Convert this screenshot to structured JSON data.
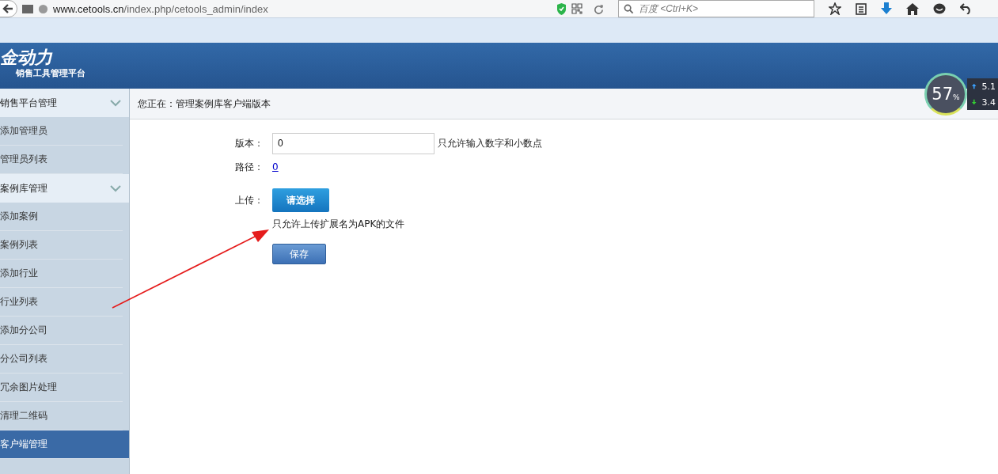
{
  "browser": {
    "url_host": "www.cetools.cn",
    "url_path": "/index.php/cetools_admin/index",
    "search_placeholder": "百度 <Ctrl+K>"
  },
  "header": {
    "logo_text": "金动力",
    "logo_subtitle": "销售工具管理平台"
  },
  "network_widget": {
    "percent": "57",
    "unit": "%",
    "upload": "5.1",
    "download": "3.4"
  },
  "breadcrumb": "您正在：管理案例库客户端版本",
  "sidebar": {
    "items": [
      {
        "label": "销售平台管理",
        "kind": "group",
        "expanded": true,
        "selected": false
      },
      {
        "label": "添加管理员",
        "kind": "item",
        "selected": false
      },
      {
        "label": "管理员列表",
        "kind": "item",
        "selected": false
      },
      {
        "label": "案例库管理",
        "kind": "group",
        "expanded": true,
        "selected": false
      },
      {
        "label": "添加案例",
        "kind": "item",
        "selected": false
      },
      {
        "label": "案例列表",
        "kind": "item",
        "selected": false
      },
      {
        "label": "添加行业",
        "kind": "item",
        "selected": false
      },
      {
        "label": "行业列表",
        "kind": "item",
        "selected": false
      },
      {
        "label": "添加分公司",
        "kind": "item",
        "selected": false
      },
      {
        "label": "分公司列表",
        "kind": "item",
        "selected": false
      },
      {
        "label": "冗余图片处理",
        "kind": "item",
        "selected": false
      },
      {
        "label": "清理二维码",
        "kind": "item",
        "selected": false
      },
      {
        "label": "客户端管理",
        "kind": "item",
        "selected": true
      }
    ]
  },
  "form": {
    "version_label": "版本：",
    "version_value": "0",
    "version_hint": "只允许输入数字和小数点",
    "path_label": "路径：",
    "path_link": "0",
    "upload_label": "上传：",
    "choose_button": "请选择",
    "upload_hint": "只允许上传扩展名为APK的文件",
    "save_button": "保存"
  }
}
